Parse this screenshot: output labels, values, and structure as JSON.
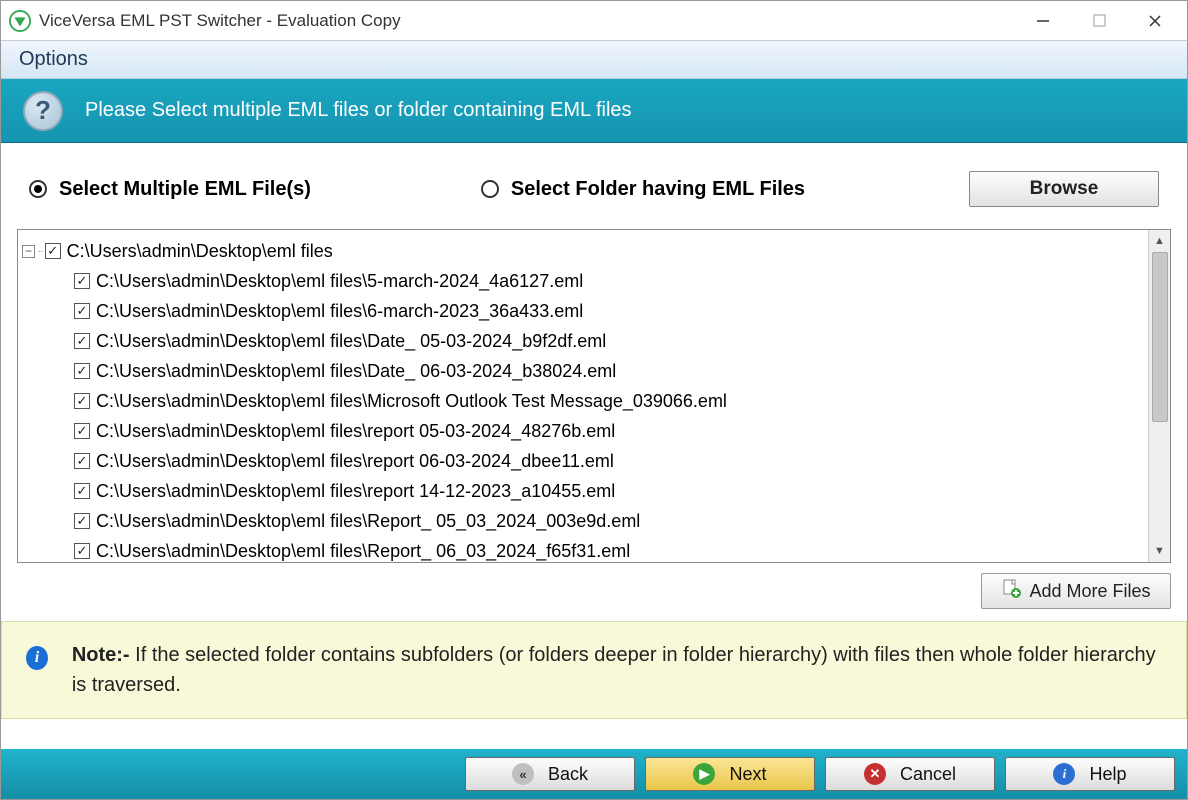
{
  "titlebar": {
    "title": "ViceVersa EML PST Switcher - Evaluation Copy"
  },
  "menubar": {
    "options": "Options"
  },
  "instruction": {
    "text": "Please Select multiple EML files or folder containing EML files"
  },
  "selection": {
    "radio_multiple": "Select Multiple EML File(s)",
    "radio_folder": "Select Folder having EML Files",
    "browse": "Browse"
  },
  "tree": {
    "root": "C:\\Users\\admin\\Desktop\\eml files",
    "items": [
      "C:\\Users\\admin\\Desktop\\eml files\\5-march-2024_4a6127.eml",
      "C:\\Users\\admin\\Desktop\\eml files\\6-march-2023_36a433.eml",
      "C:\\Users\\admin\\Desktop\\eml files\\Date_ 05-03-2024_b9f2df.eml",
      "C:\\Users\\admin\\Desktop\\eml files\\Date_ 06-03-2024_b38024.eml",
      "C:\\Users\\admin\\Desktop\\eml files\\Microsoft Outlook Test Message_039066.eml",
      "C:\\Users\\admin\\Desktop\\eml files\\report 05-03-2024_48276b.eml",
      "C:\\Users\\admin\\Desktop\\eml files\\report 06-03-2024_dbee11.eml",
      "C:\\Users\\admin\\Desktop\\eml files\\report 14-12-2023_a10455.eml",
      "C:\\Users\\admin\\Desktop\\eml files\\Report_ 05_03_2024_003e9d.eml",
      "C:\\Users\\admin\\Desktop\\eml files\\Report_ 06_03_2024_f65f31.eml"
    ]
  },
  "addmore": "Add More Files",
  "note": {
    "label": "Note:-",
    "text": " If the selected folder contains subfolders (or folders deeper in folder hierarchy) with files then whole folder hierarchy is traversed."
  },
  "buttons": {
    "back": "Back",
    "next": "Next",
    "cancel": "Cancel",
    "help": "Help"
  }
}
